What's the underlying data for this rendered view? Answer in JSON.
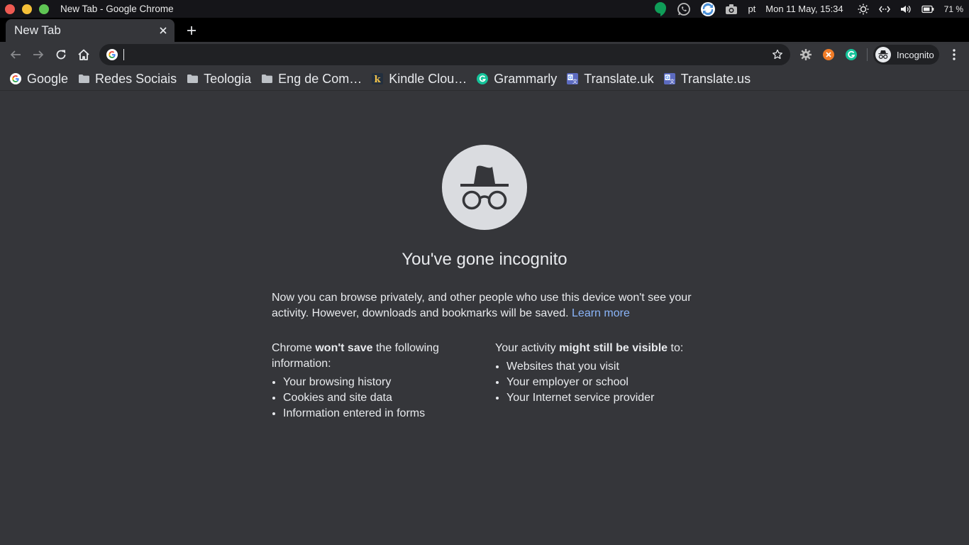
{
  "system_bar": {
    "window_title": "New Tab - Google Chrome",
    "language": "pt",
    "datetime": "Mon 11 May, 15:34",
    "battery": "71 %",
    "icons": [
      "hangouts-icon",
      "whatsapp-icon",
      "sync-icon",
      "camera-icon",
      "brightness-icon",
      "network-icon",
      "volume-icon",
      "battery-icon"
    ]
  },
  "tab": {
    "title": "New Tab"
  },
  "omnibox": {
    "value": "",
    "placeholder": ""
  },
  "profile": {
    "label": "Incognito"
  },
  "bookmarks": [
    {
      "label": "Google",
      "icon": "google-icon"
    },
    {
      "label": "Redes Sociais",
      "icon": "folder-icon"
    },
    {
      "label": "Teologia",
      "icon": "folder-icon"
    },
    {
      "label": "Eng de Com…",
      "icon": "folder-icon"
    },
    {
      "label": "Kindle Clou…",
      "icon": "kindle-icon"
    },
    {
      "label": "Grammarly",
      "icon": "grammarly-icon"
    },
    {
      "label": "Translate.uk",
      "icon": "translate-icon"
    },
    {
      "label": "Translate.us",
      "icon": "translate-icon"
    }
  ],
  "page": {
    "heading": "You've gone incognito",
    "intro": "Now you can browse privately, and other people who use this device won't see your activity. However, downloads and bookmarks will be saved.",
    "learn_more": "Learn more",
    "left_col": {
      "lead_a": "Chrome ",
      "lead_bold": "won't save",
      "lead_b": " the following information:",
      "items": [
        "Your browsing history",
        "Cookies and site data",
        "Information entered in forms"
      ]
    },
    "right_col": {
      "lead_a": "Your activity ",
      "lead_bold": "might still be visible",
      "lead_b": " to:",
      "items": [
        "Websites that you visit",
        "Your employer or school",
        "Your Internet service provider"
      ]
    }
  },
  "colors": {
    "background": "#35363a",
    "omnibox": "#202124",
    "link": "#8ab4f8",
    "spy_circle": "#dadce0"
  }
}
